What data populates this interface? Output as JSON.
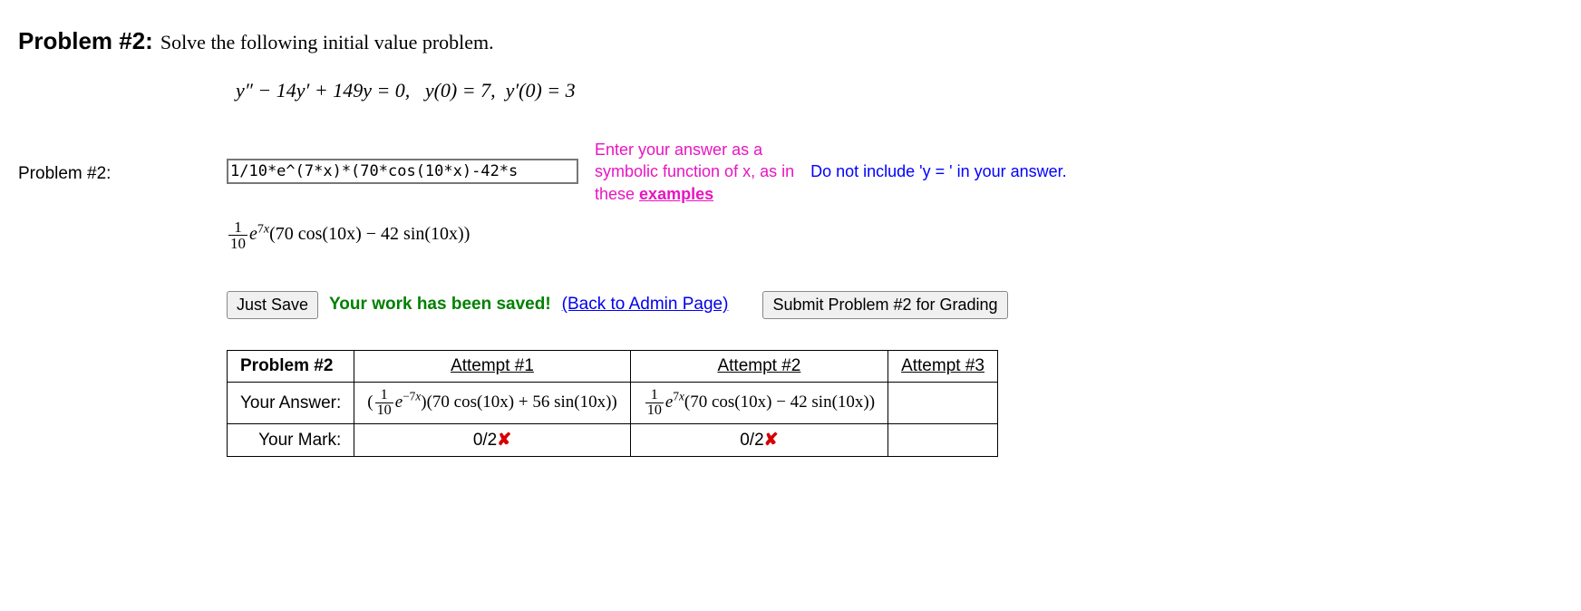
{
  "header": {
    "problem_label": "Problem #2:",
    "prompt": "Solve the following initial value problem."
  },
  "equation": {
    "ode": "y″ − 14y′ + 149y = 0,",
    "ic1": "y(0) = 7,",
    "ic2": "y′(0) = 3"
  },
  "input": {
    "side_label": "Problem #2:",
    "value": "1/10*e^(7*x)*(70*cos(10*x)-42*s",
    "hint_l1": "Enter your answer as a",
    "hint_l2": "symbolic function of x, as in",
    "hint_l3_pre": "these ",
    "hint_link": "examples",
    "warn": "Do not include 'y = ' in your answer."
  },
  "rendered": {
    "frac_num": "1",
    "frac_den": "10",
    "exp": "7",
    "body": "(70 cos(10x) − 42 sin(10x))"
  },
  "buttons": {
    "save": "Just Save",
    "submit": "Submit Problem #2 for Grading"
  },
  "status": {
    "saved": "Your work has been saved!",
    "back": "(Back to Admin Page)"
  },
  "table": {
    "title": "Problem #2",
    "row_answer": "Your Answer:",
    "row_mark": "Your Mark:",
    "cols": [
      "Attempt #1",
      "Attempt #2",
      "Attempt #3"
    ],
    "a1": {
      "frac_num": "1",
      "frac_den": "10",
      "exp": "−7",
      "body": "(70 cos(10x) + 56 sin(10x))",
      "mark": "0/2"
    },
    "a2": {
      "frac_num": "1",
      "frac_den": "10",
      "exp": "7",
      "body": "(70 cos(10x) − 42 sin(10x))",
      "mark": "0/2"
    },
    "a3": {
      "body": "",
      "mark": ""
    }
  }
}
